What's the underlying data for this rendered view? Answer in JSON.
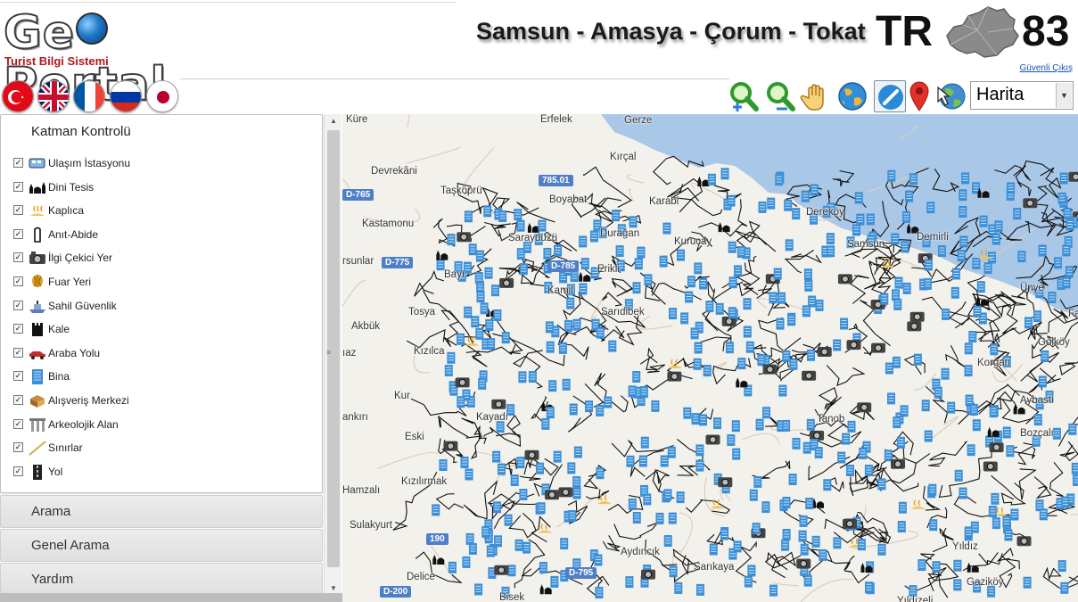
{
  "header": {
    "logo_text": "GeoPortal",
    "logo_subtitle": "Turist Bilgi Sistemi",
    "region_title": "Samsun - Amasya - Çorum - Tokat",
    "region_code_prefix": "TR",
    "region_code_number": "83",
    "logout_label": "Güvenli Çıkış"
  },
  "languages": [
    {
      "name": "turkish-flag-icon"
    },
    {
      "name": "uk-flag-icon"
    },
    {
      "name": "france-flag-icon"
    },
    {
      "name": "russia-flag-icon"
    },
    {
      "name": "japan-flag-icon"
    }
  ],
  "tools": [
    {
      "name": "zoom-in-icon"
    },
    {
      "name": "zoom-out-icon"
    },
    {
      "name": "pan-hand-icon"
    },
    {
      "name": "full-extent-globe-icon"
    },
    {
      "name": "measure-line-icon"
    },
    {
      "name": "location-marker-icon"
    },
    {
      "name": "globe-arrow-icon"
    }
  ],
  "map_type": {
    "selected": "Harita"
  },
  "layer_panel": {
    "title": "Katman Kontrolü",
    "layers": [
      {
        "label": "Ulaşım İstasyonu",
        "checked": true,
        "icon": "train-icon"
      },
      {
        "label": "Dini Tesis",
        "checked": true,
        "icon": "mosque-icon"
      },
      {
        "label": "Kaplıca",
        "checked": true,
        "icon": "hot-spring-icon"
      },
      {
        "label": "Anıt-Abide",
        "checked": true,
        "icon": "monument-icon"
      },
      {
        "label": "İlgi Çekici Yer",
        "checked": true,
        "icon": "camera-icon"
      },
      {
        "label": "Fuar Yeri",
        "checked": true,
        "icon": "balloon-icon"
      },
      {
        "label": "Sahil Güvenlik",
        "checked": true,
        "icon": "coast-guard-ship-icon"
      },
      {
        "label": "Kale",
        "checked": true,
        "icon": "castle-icon"
      },
      {
        "label": "Araba Yolu",
        "checked": true,
        "icon": "car-icon"
      },
      {
        "label": "Bina",
        "checked": true,
        "icon": "building-icon"
      },
      {
        "label": "Alışveriş Merkezi",
        "checked": true,
        "icon": "shopping-icon"
      },
      {
        "label": "Arkeolojik Alan",
        "checked": true,
        "icon": "ruins-icon"
      },
      {
        "label": "Sınırlar",
        "checked": true,
        "icon": "border-line-icon"
      },
      {
        "label": "Yol",
        "checked": true,
        "icon": "road-icon"
      }
    ]
  },
  "accordion": [
    {
      "label": "Arama"
    },
    {
      "label": "Genel Arama"
    },
    {
      "label": "Yardım"
    }
  ],
  "map": {
    "places": [
      {
        "name": "Küre"
      },
      {
        "name": "Erfelek"
      },
      {
        "name": "Gerze"
      },
      {
        "name": "Kırçal"
      },
      {
        "name": "Devrekâni"
      },
      {
        "name": "Taşköprü"
      },
      {
        "name": "Boyabat"
      },
      {
        "name": "Karabi"
      },
      {
        "name": "Dereköy"
      },
      {
        "name": "Kastamonu"
      },
      {
        "name": "Saraydüzü"
      },
      {
        "name": "Durağan"
      },
      {
        "name": "Kuruçay"
      },
      {
        "name": "Samsun"
      },
      {
        "name": "Demirli"
      },
      {
        "name": "Ünye"
      },
      {
        "name": "rsunlar"
      },
      {
        "name": "Bayı"
      },
      {
        "name": "Erikli"
      },
      {
        "name": "Kamil"
      },
      {
        "name": "Tosya"
      },
      {
        "name": "Sarıdibek"
      },
      {
        "name": "Fat"
      },
      {
        "name": "Akbük"
      },
      {
        "name": "Gölköy"
      },
      {
        "name": "ıaz"
      },
      {
        "name": "Kızılca"
      },
      {
        "name": "Korgan"
      },
      {
        "name": "Kur"
      },
      {
        "name": "Aybastı"
      },
      {
        "name": "ankırı"
      },
      {
        "name": "Kayadı"
      },
      {
        "name": "Tanob"
      },
      {
        "name": "Eski"
      },
      {
        "name": "Bozçalı"
      },
      {
        "name": "Hamzalı"
      },
      {
        "name": "Kızılırmak"
      },
      {
        "name": "Sulakyurt"
      },
      {
        "name": "Yıldız"
      },
      {
        "name": "Aydıncık"
      },
      {
        "name": "Sarıkaya"
      },
      {
        "name": "Delice"
      },
      {
        "name": "Gaziköy"
      },
      {
        "name": "Bisek"
      },
      {
        "name": "Yıldızeli"
      }
    ],
    "road_shields": [
      {
        "label": "785.01"
      },
      {
        "label": "D-765"
      },
      {
        "label": "D-775"
      },
      {
        "label": "D-785"
      },
      {
        "label": "D-795"
      },
      {
        "label": "D-200"
      },
      {
        "label": "190"
      }
    ],
    "colors": {
      "sea": "#a9c7e7",
      "land": "#f3f1ec",
      "road": "#111111",
      "poi": "#3c8fd6"
    }
  }
}
